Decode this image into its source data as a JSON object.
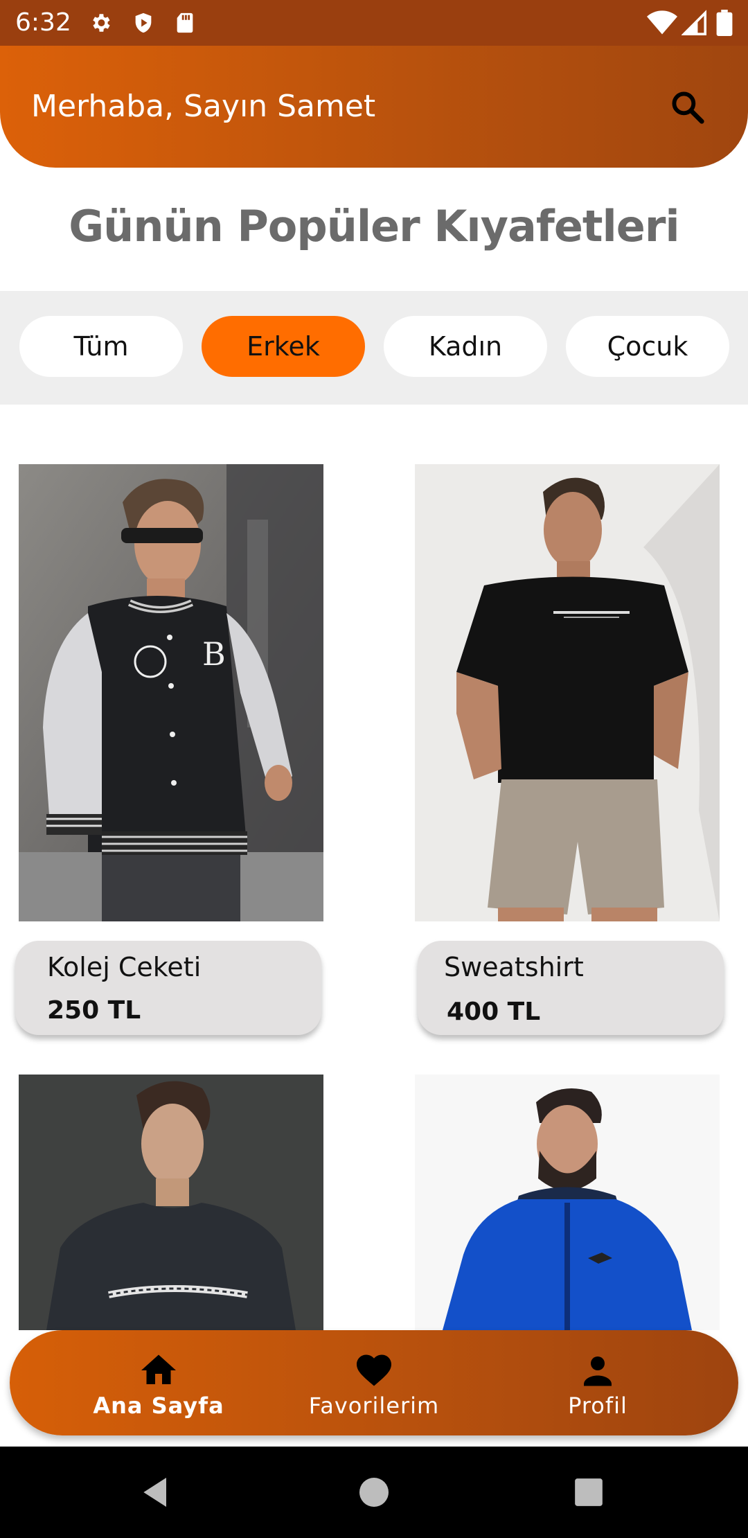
{
  "status_bar": {
    "time": "6:32",
    "left_icons": [
      "settings-icon",
      "shield-icon",
      "sd-card-icon"
    ],
    "right_icons": [
      "wifi-icon",
      "signal-icon",
      "battery-icon"
    ]
  },
  "header": {
    "greeting": "Merhaba, Sayın Samet",
    "search_icon": "search-icon"
  },
  "page_title": "Günün Popüler Kıyafetleri",
  "filters": {
    "items": [
      "Tüm",
      "Erkek",
      "Kadın",
      "Çocuk"
    ],
    "selected": "Erkek",
    "active_color": "#ff6d00"
  },
  "products": [
    {
      "name": "Kolej Ceketi",
      "price": "250 TL"
    },
    {
      "name": "Sweatshirt",
      "price": "400 TL"
    },
    {
      "name": "",
      "price": ""
    },
    {
      "name": "",
      "price": ""
    }
  ],
  "bottom_nav": {
    "items": [
      {
        "label": "Ana Sayfa",
        "icon": "home-icon",
        "active": true
      },
      {
        "label": "Favorilerim",
        "icon": "heart-icon",
        "active": false
      },
      {
        "label": "Profil",
        "icon": "person-icon",
        "active": false
      }
    ]
  },
  "system_nav": [
    "back-icon",
    "home-circle-icon",
    "recents-icon"
  ],
  "colors": {
    "brand_orange": "#dc6109",
    "brand_dark": "#9a3f0f",
    "card_bg": "#e3e1e1",
    "title_gray": "#6b6b6b"
  }
}
